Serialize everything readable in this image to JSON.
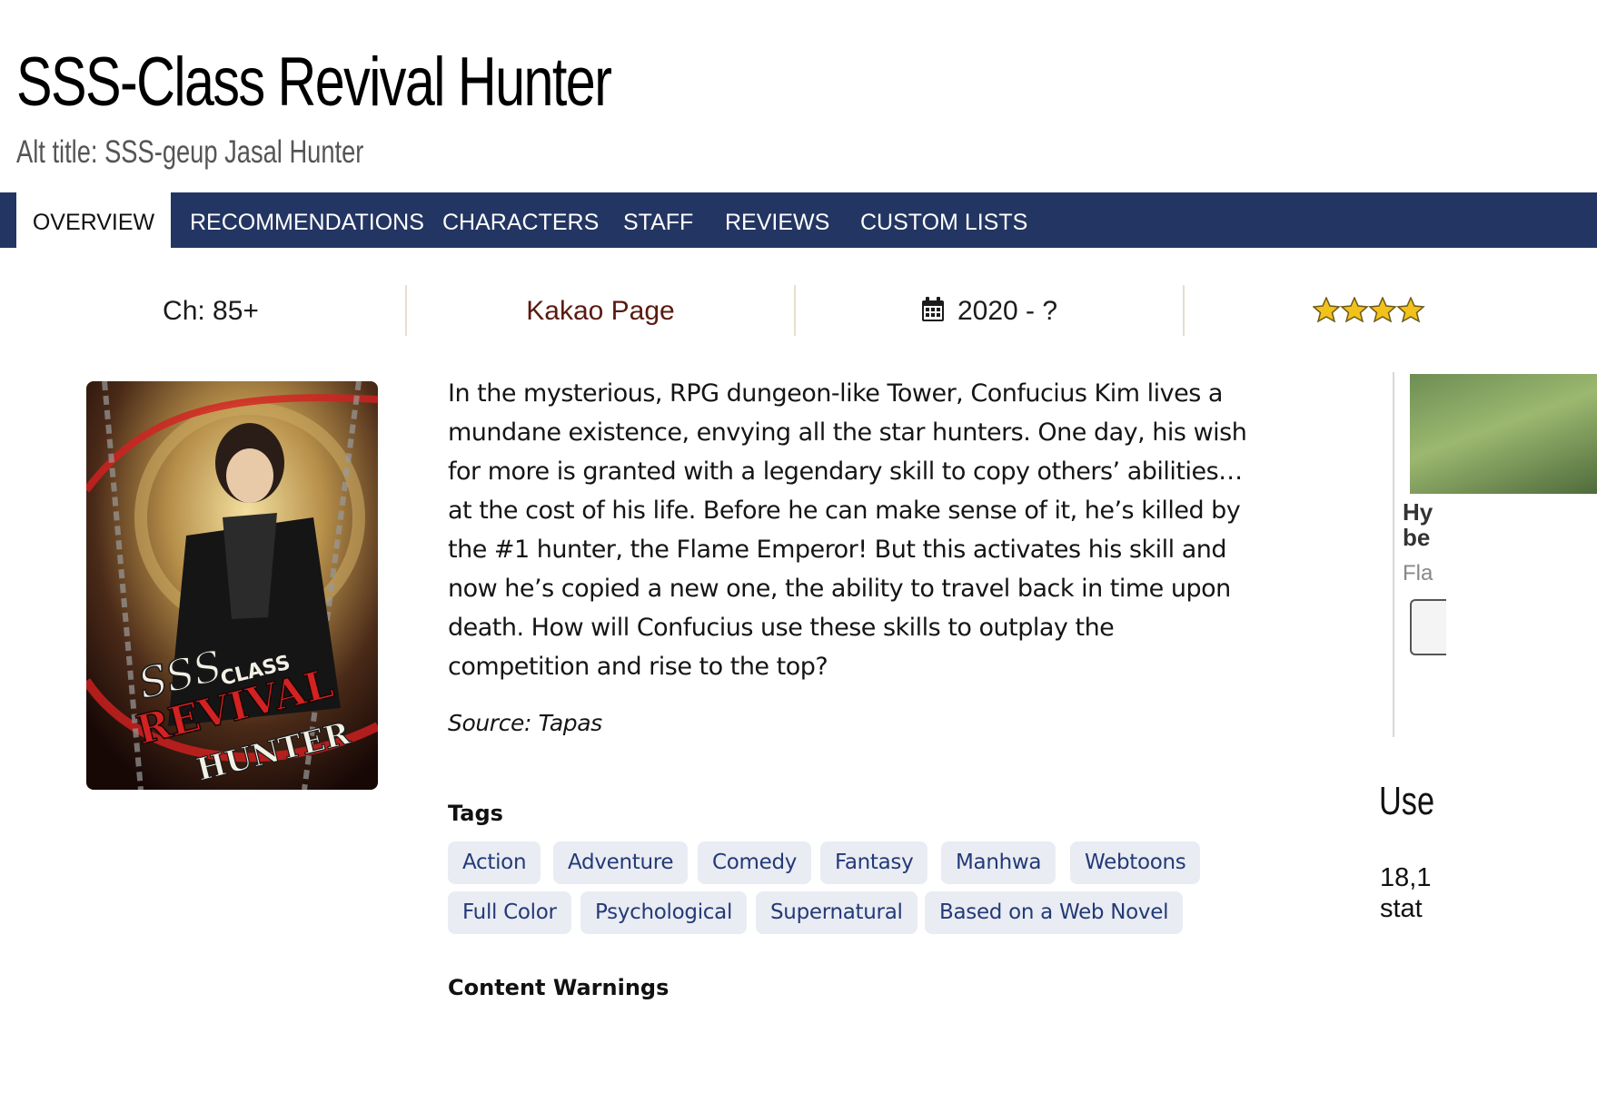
{
  "title": "SSS-Class Revival Hunter",
  "alt_title": "Alt title: SSS-geup Jasal Hunter",
  "tabs": [
    {
      "label": "OVERVIEW",
      "active": true
    },
    {
      "label": "RECOMMENDATIONS",
      "active": false
    },
    {
      "label": "CHARACTERS",
      "active": false
    },
    {
      "label": "STAFF",
      "active": false
    },
    {
      "label": "REVIEWS",
      "active": false
    },
    {
      "label": "CUSTOM LISTS",
      "active": false
    }
  ],
  "stats": {
    "chapters": "Ch: 85+",
    "publisher": "Kakao Page",
    "years": "2020 - ?",
    "calendar_icon": "calendar-icon",
    "rating_icon": "star-icon"
  },
  "cover": {
    "line1": "SSS",
    "line1b": "CLASS",
    "line2": "REVIVAL",
    "line3": "HUNTER"
  },
  "synopsis": "In the mysterious, RPG dungeon-like Tower, Confucius Kim lives a mundane existence, envying all the star hunters. One day, his wish for more is granted with a legendary skill to copy others’ abilities… at the cost of his life. Before he can make sense of it, he’s killed by the #1 hunter, the Flame Emperor! But this activates his skill and now he’s copied a new one, the ability to travel back in time upon death. How will Confucius use these skills to outplay the competition and rise to the top?",
  "source": "Source: Tapas",
  "tags_heading": "Tags",
  "tags": [
    "Action",
    "Adventure",
    "Comedy",
    "Fantasy",
    "Manhwa",
    "Webtoons",
    "Full Color",
    "Psychological",
    "Supernatural",
    "Based on a Web Novel"
  ],
  "content_warnings_heading": "Content Warnings",
  "right_column": {
    "card_title_line1": "Hy",
    "card_title_line2": "be",
    "card_sub": "Fla",
    "heading": "Use",
    "stat_line1": "18,1",
    "stat_line2": "stat"
  },
  "colors": {
    "tabbar": "#233562",
    "publisher": "#5a1a10",
    "tag_bg": "#e9ecf2",
    "tag_text": "#233a78",
    "star": "#f2c21b"
  }
}
